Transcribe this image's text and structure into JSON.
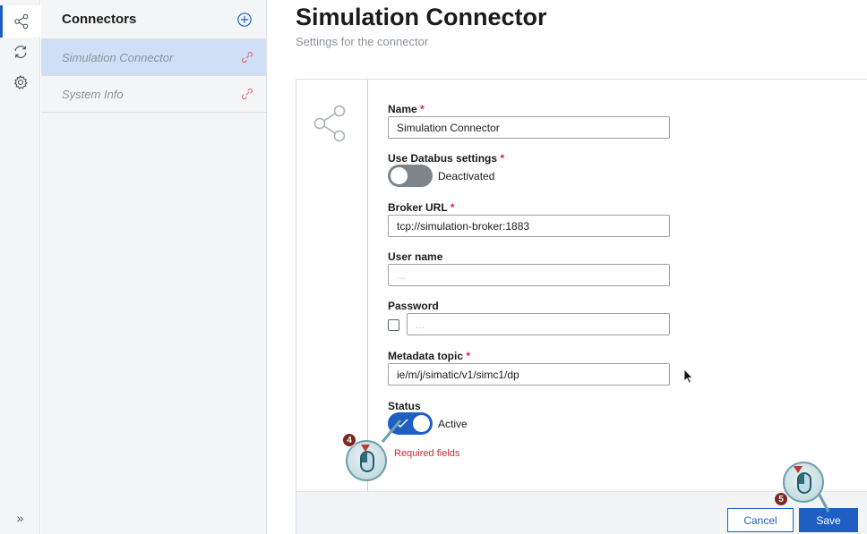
{
  "rail": {
    "items": [
      {
        "icon": "share-icon",
        "active": true
      },
      {
        "icon": "sync-icon",
        "active": false
      },
      {
        "icon": "gear-icon",
        "active": false
      }
    ],
    "expand_icon": "chevron-double-right-icon",
    "expand_label": "»"
  },
  "connectors": {
    "title": "Connectors",
    "add_icon": "add-circle-icon",
    "items": [
      {
        "label": "Simulation Connector",
        "selected": true,
        "icon": "link-icon"
      },
      {
        "label": "System Info",
        "selected": false,
        "icon": "link-icon"
      }
    ]
  },
  "page": {
    "title": "Simulation Connector",
    "subtitle": "Settings for the connector"
  },
  "form": {
    "name": {
      "label": "Name",
      "required": "*",
      "value": "Simulation Connector"
    },
    "databus": {
      "label": "Use Databus settings",
      "required": "*",
      "state": "Deactivated",
      "on": false
    },
    "broker_url": {
      "label": "Broker URL",
      "required": "*",
      "value": "tcp://simulation-broker:1883"
    },
    "user_name": {
      "label": "User name",
      "placeholder": "..."
    },
    "password": {
      "label": "Password",
      "placeholder": "..."
    },
    "metadata_topic": {
      "label": "Metadata topic",
      "required": "*",
      "value": "ie/m/j/simatic/v1/simc1/dp"
    },
    "status": {
      "label": "Status",
      "state": "Active",
      "on": true
    },
    "required_note": "Required fields"
  },
  "actions": {
    "cancel": "Cancel",
    "save": "Save"
  },
  "markers": [
    {
      "number": "4",
      "target": "status-toggle"
    },
    {
      "number": "5",
      "target": "save-button"
    }
  ],
  "colors": {
    "accent": "#1f5fc4",
    "required": "#d72638",
    "selected_row": "#cfe0f6",
    "link_icon": "#e05a6b"
  }
}
